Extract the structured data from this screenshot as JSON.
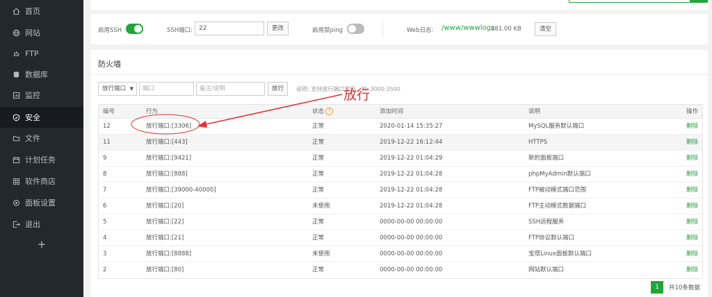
{
  "sidebar": {
    "items": [
      {
        "label": "首页",
        "icon": "home-icon"
      },
      {
        "label": "网站",
        "icon": "globe-icon"
      },
      {
        "label": "FTP",
        "icon": "ftp-icon"
      },
      {
        "label": "数据库",
        "icon": "database-icon"
      },
      {
        "label": "监控",
        "icon": "monitor-icon"
      },
      {
        "label": "安全",
        "icon": "shield-icon",
        "active": true
      },
      {
        "label": "文件",
        "icon": "folder-icon"
      },
      {
        "label": "计划任务",
        "icon": "calendar-icon"
      },
      {
        "label": "软件商店",
        "icon": "grid-icon"
      },
      {
        "label": "面板设置",
        "icon": "settings-icon"
      },
      {
        "label": "退出",
        "icon": "logout-icon"
      }
    ],
    "plus": "+"
  },
  "settings": {
    "ssh_label": "启用SSH",
    "ssh_enabled": true,
    "port_label": "SSH端口:",
    "port_value": "22",
    "change_button": "更改",
    "ping_label": "启用禁ping",
    "ping_enabled": false,
    "weblog_label": "Web日志:",
    "weblog_path": "/www/wwwlogs",
    "weblog_size": "881.00 KB",
    "clear_button": "清空"
  },
  "firewall": {
    "title": "防火墙",
    "select_value": "放行端口",
    "port_placeholder": "端口",
    "remark_placeholder": "备注/说明",
    "allow_button": "放行",
    "hint": "说明: 支持放行端口范围，如: 3000:3500",
    "columns": [
      "编号",
      "行为",
      "状态",
      "添加时间",
      "说明",
      "操作"
    ],
    "rows": [
      {
        "id": "12",
        "action": "放行端口:[3306]",
        "status": "正常",
        "time": "2020-01-14 15:35:27",
        "desc": "MySQL服务默认端口",
        "op": "删除"
      },
      {
        "id": "11",
        "action": "放行端口:[443]",
        "status": "正常",
        "time": "2019-12-22 16:12:44",
        "desc": "HTTPS",
        "op": "删除"
      },
      {
        "id": "9",
        "action": "放行端口:[9421]",
        "status": "正常",
        "time": "2019-12-22 01:04:29",
        "desc": "新的面板端口",
        "op": "删除"
      },
      {
        "id": "8",
        "action": "放行端口:[888]",
        "status": "正常",
        "time": "2019-12-22 01:04:28",
        "desc": "phpMyAdmin默认端口",
        "op": "删除"
      },
      {
        "id": "7",
        "action": "放行端口:[39000-40000]",
        "status": "正常",
        "time": "2019-12-22 01:04:28",
        "desc": "FTP被动模式端口范围",
        "op": "删除"
      },
      {
        "id": "6",
        "action": "放行端口:[20]",
        "status": "未使用",
        "time": "2019-12-22 01:04:28",
        "desc": "FTP主动模式数据端口",
        "op": "删除"
      },
      {
        "id": "5",
        "action": "放行端口:[22]",
        "status": "正常",
        "time": "0000-00-00 00:00:00",
        "desc": "SSH远程服务",
        "op": "删除"
      },
      {
        "id": "4",
        "action": "放行端口:[21]",
        "status": "正常",
        "time": "0000-00-00 00:00:00",
        "desc": "FTP协议默认端口",
        "op": "删除"
      },
      {
        "id": "3",
        "action": "放行端口:[8888]",
        "status": "未使用",
        "time": "0000-00-00 00:00:00",
        "desc": "宝塔Linux面板默认端口",
        "op": "删除"
      },
      {
        "id": "2",
        "action": "放行端口:[80]",
        "status": "正常",
        "time": "0000-00-00 00:00:00",
        "desc": "网站默认端口",
        "op": "删除"
      }
    ],
    "pager": {
      "current": "1",
      "total": "共10条数据"
    }
  },
  "annotation": {
    "text": "放行",
    "color": "#e53030"
  },
  "colors": {
    "accent": "#20a53a",
    "sidebar_bg": "#23282f"
  }
}
